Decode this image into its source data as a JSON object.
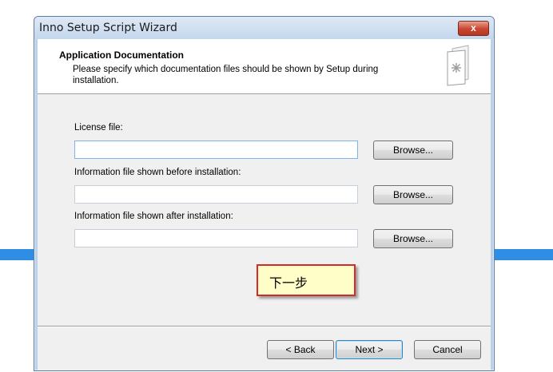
{
  "window": {
    "title": "Inno Setup Script Wizard",
    "close_glyph": "x"
  },
  "header": {
    "title": "Application Documentation",
    "description": "Please specify which documentation files should be shown by Setup during installation.",
    "icon": "document-icon"
  },
  "fields": [
    {
      "label": "License file:",
      "value": "",
      "browse_label": "Browse..."
    },
    {
      "label": "Information file shown before installation:",
      "value": "",
      "browse_label": "Browse..."
    },
    {
      "label": "Information file shown after installation:",
      "value": "",
      "browse_label": "Browse..."
    }
  ],
  "callout": {
    "text": "下一步"
  },
  "buttons": {
    "back": "< Back",
    "next": "Next >",
    "cancel": "Cancel"
  },
  "colors": {
    "accent_stripe": "#2f8de4",
    "callout_border": "#d32a2a",
    "callout_fill": "#fffdc8"
  }
}
